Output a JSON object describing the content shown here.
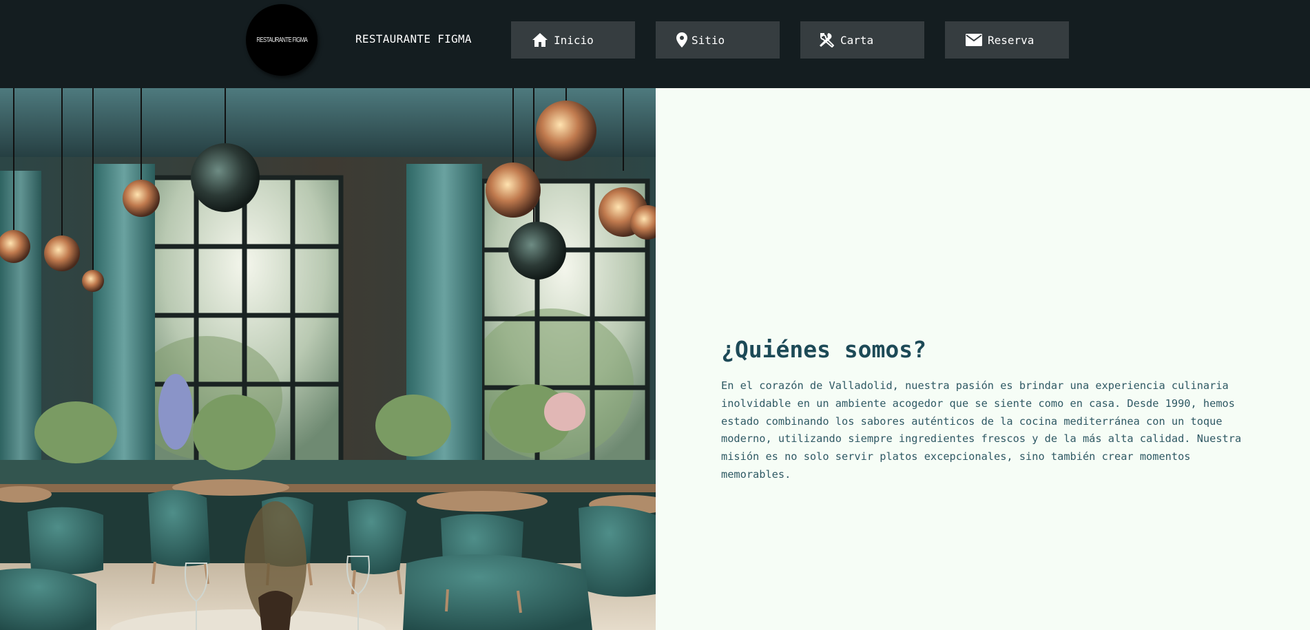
{
  "header": {
    "logo_text": "RESTAURANTE FIGMA",
    "brand_name": "RESTAURANTE FIGMA",
    "nav": [
      {
        "label": "Inicio",
        "icon": "home-icon"
      },
      {
        "label": "Sitio",
        "icon": "location-pin-icon"
      },
      {
        "label": "Carta",
        "icon": "cutlery-icon"
      },
      {
        "label": "Reserva",
        "icon": "mail-icon"
      }
    ]
  },
  "hero": {
    "image": "restaurant-interior-photo"
  },
  "about": {
    "title": "¿Quiénes somos?",
    "body": "En el corazón de Valladolid, nuestra pasión es brindar una experiencia culinaria inolvidable en un ambiente acogedor que se siente como en casa. Desde 1990, hemos estado combinando los sabores auténticos de la cocina mediterránea con un toque moderno, utilizando siempre ingredientes frescos y de la más alta calidad. Nuestra misión es no solo servir platos excepcionales, sino también crear momentos memorables."
  },
  "colors": {
    "header_bg": "#141d20",
    "nav_button_bg": "#363d40",
    "page_bg": "#f6fdf6",
    "title_color": "#1d4a57",
    "body_color": "#2f5964"
  }
}
